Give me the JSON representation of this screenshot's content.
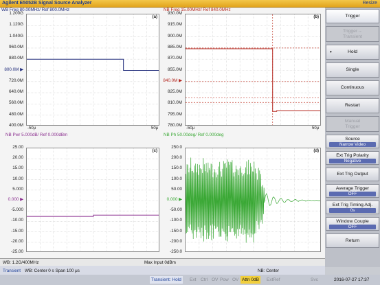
{
  "app": {
    "title": "Agilent E5052B Signal Source Analyzer",
    "resize_label": "Resize"
  },
  "panels": {
    "a": {
      "title": "WB Freq 80.00MHz/ Ref 800.0MHz",
      "label": "(a)",
      "ylabels": [
        "1.200G",
        "1.120G",
        "1.040G",
        "960.0M",
        "880.0M",
        "800.0M",
        "720.0M",
        "640.0M",
        "560.0M",
        "480.0M",
        "400.0M"
      ],
      "ref_index": 5,
      "xstart": "-50μ",
      "xend": "50μ"
    },
    "b": {
      "title": "NB Freq 15.00MHz/ Ref 840.0MHz",
      "label": "(b)",
      "ylabels": [
        "930.0M",
        "915.0M",
        "900.0M",
        "885.0M",
        "870.0M",
        "855.0M",
        "840.0M",
        "825.0M",
        "810.0M",
        "795.0M",
        "780.0M"
      ],
      "ref_index": 6,
      "xstart": "-50μ",
      "xend": "50μ"
    },
    "c": {
      "title": "NB Pwr 5.000dB/ Ref 0.000dBm",
      "label": "(c)",
      "ylabels": [
        "25.00",
        "20.00",
        "15.00",
        "10.00",
        "5.000",
        "0.000",
        "-5.000",
        "-10.00",
        "-15.00",
        "-20.00",
        "-25.00"
      ],
      "ref_index": 5,
      "xstart": "-50μ",
      "xend": "50μ"
    },
    "d": {
      "title": "NB Ph 50.00deg/ Ref 0.000deg",
      "label": "(d)",
      "ylabels": [
        "250.0",
        "200.0",
        "150.0",
        "100.0",
        "50.00",
        "0.000",
        "-50.00",
        "-100.0",
        "-150.0",
        "-200.0",
        "-250.0"
      ],
      "ref_index": 5,
      "xstart": "-50μ",
      "xend": "50μ"
    }
  },
  "status": {
    "wb": "WB: 1.2G/400MHz",
    "max_input": "Max Input 0dBm",
    "transient": "Transient",
    "wb_center": "WB: Center 0 s  Span 100 μs",
    "nb_center": "NB: Center"
  },
  "bottombar": {
    "mode": "Transient: Hold",
    "items": [
      "Ext",
      "Ctrl",
      "OV",
      "Pow",
      "OV"
    ],
    "attn": "Attn 0dB",
    "items2": [
      "ExtRef",
      "Svc"
    ],
    "datetime": "2016-07-27 17:37"
  },
  "softkeys": [
    {
      "label": "Trigger",
      "type": "header"
    },
    {
      "label": "Trigger→\nTransient",
      "type": "disabled"
    },
    {
      "label": "Hold",
      "type": "selected"
    },
    {
      "label": "Single",
      "type": "normal"
    },
    {
      "label": "Continuous",
      "type": "normal"
    },
    {
      "label": "Restart",
      "type": "normal"
    },
    {
      "label": "Manual\nTrigger",
      "type": "disabled"
    },
    {
      "label": "Source",
      "sub": "Narrow Video",
      "type": "normal"
    },
    {
      "label": "Ext Trig Polarity",
      "sub": "Negative",
      "type": "normal"
    },
    {
      "label": "Ext Trig Output",
      "type": "normal"
    },
    {
      "label": "Average Trigger",
      "sub": "OFF",
      "type": "normal"
    },
    {
      "label": "Ext Trig Timing Adj.",
      "sub": "0s",
      "type": "normal"
    },
    {
      "label": "Window Couple",
      "sub": "OFF",
      "type": "normal"
    },
    {
      "label": "Return",
      "type": "normal"
    }
  ],
  "colors": {
    "wb": "#1e2a7a",
    "nb_freq": "#b3261e",
    "nb_pwr": "#8a2f8f",
    "nb_ph": "#3aa835",
    "ref_marker": "#2a4fc9"
  }
}
